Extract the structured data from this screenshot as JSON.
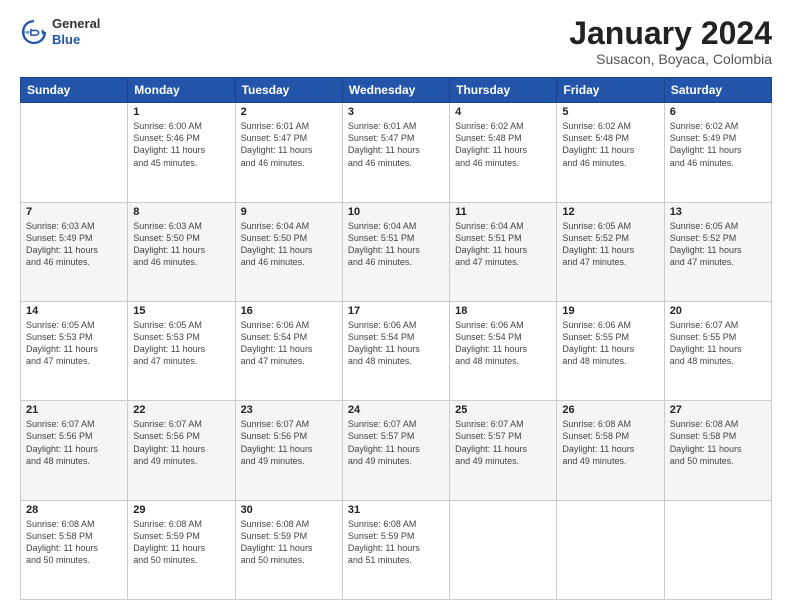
{
  "header": {
    "logo_general": "General",
    "logo_blue": "Blue",
    "month": "January 2024",
    "location": "Susacon, Boyaca, Colombia"
  },
  "weekdays": [
    "Sunday",
    "Monday",
    "Tuesday",
    "Wednesday",
    "Thursday",
    "Friday",
    "Saturday"
  ],
  "weeks": [
    [
      {
        "day": "",
        "info": ""
      },
      {
        "day": "1",
        "info": "Sunrise: 6:00 AM\nSunset: 5:46 PM\nDaylight: 11 hours\nand 45 minutes."
      },
      {
        "day": "2",
        "info": "Sunrise: 6:01 AM\nSunset: 5:47 PM\nDaylight: 11 hours\nand 46 minutes."
      },
      {
        "day": "3",
        "info": "Sunrise: 6:01 AM\nSunset: 5:47 PM\nDaylight: 11 hours\nand 46 minutes."
      },
      {
        "day": "4",
        "info": "Sunrise: 6:02 AM\nSunset: 5:48 PM\nDaylight: 11 hours\nand 46 minutes."
      },
      {
        "day": "5",
        "info": "Sunrise: 6:02 AM\nSunset: 5:48 PM\nDaylight: 11 hours\nand 46 minutes."
      },
      {
        "day": "6",
        "info": "Sunrise: 6:02 AM\nSunset: 5:49 PM\nDaylight: 11 hours\nand 46 minutes."
      }
    ],
    [
      {
        "day": "7",
        "info": "Sunrise: 6:03 AM\nSunset: 5:49 PM\nDaylight: 11 hours\nand 46 minutes."
      },
      {
        "day": "8",
        "info": "Sunrise: 6:03 AM\nSunset: 5:50 PM\nDaylight: 11 hours\nand 46 minutes."
      },
      {
        "day": "9",
        "info": "Sunrise: 6:04 AM\nSunset: 5:50 PM\nDaylight: 11 hours\nand 46 minutes."
      },
      {
        "day": "10",
        "info": "Sunrise: 6:04 AM\nSunset: 5:51 PM\nDaylight: 11 hours\nand 46 minutes."
      },
      {
        "day": "11",
        "info": "Sunrise: 6:04 AM\nSunset: 5:51 PM\nDaylight: 11 hours\nand 47 minutes."
      },
      {
        "day": "12",
        "info": "Sunrise: 6:05 AM\nSunset: 5:52 PM\nDaylight: 11 hours\nand 47 minutes."
      },
      {
        "day": "13",
        "info": "Sunrise: 6:05 AM\nSunset: 5:52 PM\nDaylight: 11 hours\nand 47 minutes."
      }
    ],
    [
      {
        "day": "14",
        "info": "Sunrise: 6:05 AM\nSunset: 5:53 PM\nDaylight: 11 hours\nand 47 minutes."
      },
      {
        "day": "15",
        "info": "Sunrise: 6:05 AM\nSunset: 5:53 PM\nDaylight: 11 hours\nand 47 minutes."
      },
      {
        "day": "16",
        "info": "Sunrise: 6:06 AM\nSunset: 5:54 PM\nDaylight: 11 hours\nand 47 minutes."
      },
      {
        "day": "17",
        "info": "Sunrise: 6:06 AM\nSunset: 5:54 PM\nDaylight: 11 hours\nand 48 minutes."
      },
      {
        "day": "18",
        "info": "Sunrise: 6:06 AM\nSunset: 5:54 PM\nDaylight: 11 hours\nand 48 minutes."
      },
      {
        "day": "19",
        "info": "Sunrise: 6:06 AM\nSunset: 5:55 PM\nDaylight: 11 hours\nand 48 minutes."
      },
      {
        "day": "20",
        "info": "Sunrise: 6:07 AM\nSunset: 5:55 PM\nDaylight: 11 hours\nand 48 minutes."
      }
    ],
    [
      {
        "day": "21",
        "info": "Sunrise: 6:07 AM\nSunset: 5:56 PM\nDaylight: 11 hours\nand 48 minutes."
      },
      {
        "day": "22",
        "info": "Sunrise: 6:07 AM\nSunset: 5:56 PM\nDaylight: 11 hours\nand 49 minutes."
      },
      {
        "day": "23",
        "info": "Sunrise: 6:07 AM\nSunset: 5:56 PM\nDaylight: 11 hours\nand 49 minutes."
      },
      {
        "day": "24",
        "info": "Sunrise: 6:07 AM\nSunset: 5:57 PM\nDaylight: 11 hours\nand 49 minutes."
      },
      {
        "day": "25",
        "info": "Sunrise: 6:07 AM\nSunset: 5:57 PM\nDaylight: 11 hours\nand 49 minutes."
      },
      {
        "day": "26",
        "info": "Sunrise: 6:08 AM\nSunset: 5:58 PM\nDaylight: 11 hours\nand 49 minutes."
      },
      {
        "day": "27",
        "info": "Sunrise: 6:08 AM\nSunset: 5:58 PM\nDaylight: 11 hours\nand 50 minutes."
      }
    ],
    [
      {
        "day": "28",
        "info": "Sunrise: 6:08 AM\nSunset: 5:58 PM\nDaylight: 11 hours\nand 50 minutes."
      },
      {
        "day": "29",
        "info": "Sunrise: 6:08 AM\nSunset: 5:59 PM\nDaylight: 11 hours\nand 50 minutes."
      },
      {
        "day": "30",
        "info": "Sunrise: 6:08 AM\nSunset: 5:59 PM\nDaylight: 11 hours\nand 50 minutes."
      },
      {
        "day": "31",
        "info": "Sunrise: 6:08 AM\nSunset: 5:59 PM\nDaylight: 11 hours\nand 51 minutes."
      },
      {
        "day": "",
        "info": ""
      },
      {
        "day": "",
        "info": ""
      },
      {
        "day": "",
        "info": ""
      }
    ]
  ]
}
